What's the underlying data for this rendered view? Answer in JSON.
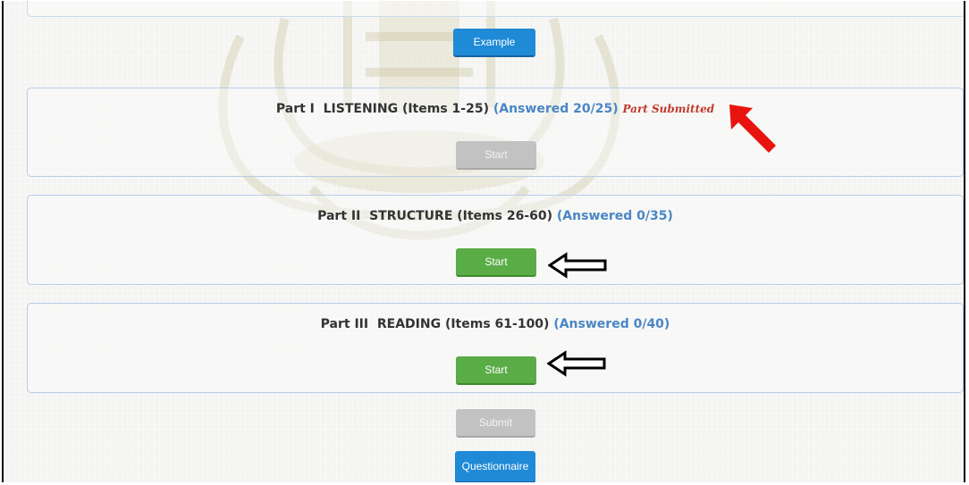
{
  "example_button_label": "Example",
  "parts": [
    {
      "title": "Part I  LISTENING (Items 1-25)",
      "answered": "(Answered 20/25)",
      "status": "Part Submitted",
      "start_label": "Start",
      "start_enabled": false
    },
    {
      "title": "Part II  STRUCTURE (Items 26-60)",
      "answered": "(Answered 0/35)",
      "status": "",
      "start_label": "Start",
      "start_enabled": true
    },
    {
      "title": "Part III  READING (Items 61-100)",
      "answered": "(Answered 0/40)",
      "status": "",
      "start_label": "Start",
      "start_enabled": true
    }
  ],
  "submit_button_label": "Submit",
  "questionnaire_button_label": "Questionnaire",
  "colors": {
    "primary_blue": "#1f8ad6",
    "start_green": "#5aac46",
    "disabled_gray": "#c2c2c2",
    "answered_blue": "#4a86c5",
    "submitted_red": "#c0392b",
    "annotation_red": "#e8140f"
  },
  "annotations": {
    "red_arrow_icon": "arrow-up-left",
    "black_arrow_icon": "arrow-left-outline"
  }
}
